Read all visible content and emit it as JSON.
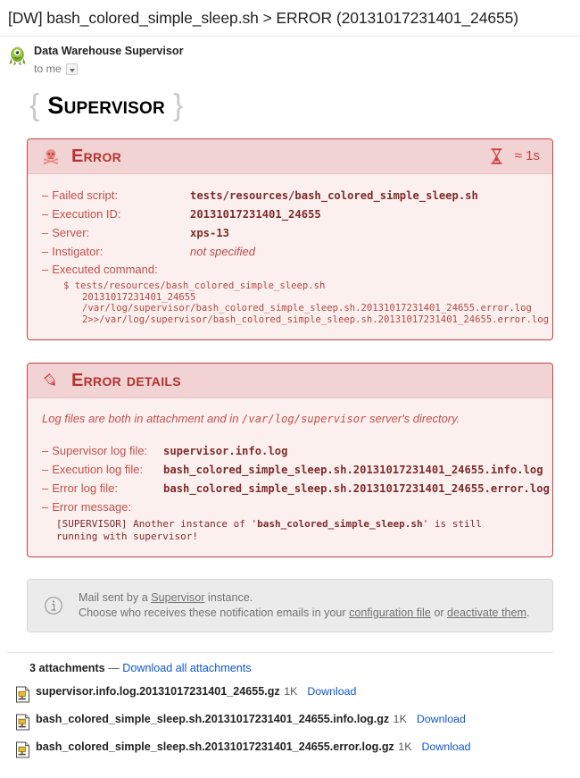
{
  "subject": "[DW] bash_colored_simple_sleep.sh > ERROR (20131017231401_24655)",
  "sender": {
    "name": "Data Warehouse Supervisor",
    "recipient": "to me",
    "avatar_icon": "green-monster-avatar-icon",
    "caret_icon": "chevron-down-icon"
  },
  "wordmark": {
    "left_brace": "{",
    "text": "Supervisor",
    "right_brace": "}"
  },
  "error_panel": {
    "icon": "skull-and-crossbones-icon",
    "title": "Error",
    "duration_icon": "hourglass-icon",
    "duration": "≈ 1s",
    "rows": [
      {
        "key": "Failed script:",
        "value": "tests/resources/bash_colored_simple_sleep.sh",
        "style": "mono"
      },
      {
        "key": "Execution ID:",
        "value": "20131017231401_24655",
        "style": "mono"
      },
      {
        "key": "Server:",
        "value": "xps-13",
        "style": "mono"
      },
      {
        "key": "Instigator:",
        "value": "not specified",
        "style": "plain"
      }
    ],
    "command_label": "Executed command:",
    "command_lines": [
      "$ tests/resources/bash_colored_simple_sleep.sh",
      "20131017231401_24655",
      "/var/log/supervisor/bash_colored_simple_sleep.sh.20131017231401_24655.error.log",
      "2>>/var/log/supervisor/bash_colored_simple_sleep.sh.20131017231401_24655.error.log"
    ]
  },
  "details_panel": {
    "icon": "pen-nib-icon",
    "title": "Error details",
    "note_prefix": "Log files are both in attachment and in ",
    "note_path": "/var/log/supervisor",
    "note_suffix": " server's directory.",
    "rows": [
      {
        "key": "Supervisor log file:",
        "value": "supervisor.info.log"
      },
      {
        "key": "Execution log file:",
        "value": "bash_colored_simple_sleep.sh.20131017231401_24655.info.log"
      },
      {
        "key": "Error log file:",
        "value": "bash_colored_simple_sleep.sh.20131017231401_24655.error.log"
      }
    ],
    "message_label": "Error message:",
    "message_pre": "[SUPERVISOR] Another instance of '",
    "message_bold": "bash_colored_simple_sleep.sh",
    "message_post": "' is still running with supervisor!"
  },
  "info_box": {
    "icon": "info-circle-icon",
    "line1_pre": "Mail sent by a ",
    "line1_link": "Supervisor",
    "line1_post": " instance.",
    "line2_pre": "Choose who receives these notification emails in your ",
    "line2_link1": "configuration file",
    "line2_mid": " or ",
    "line2_link2": "deactivate them",
    "line2_post": "."
  },
  "attachments": {
    "count_label": "3 attachments",
    "separator": "—",
    "download_all": "Download all attachments",
    "items": [
      {
        "icon": "gzip-file-icon",
        "name": "supervisor.info.log.20131017231401_24655.gz",
        "size": "1K",
        "action": "Download"
      },
      {
        "icon": "gzip-file-icon",
        "name": "bash_colored_simple_sleep.sh.20131017231401_24655.info.log.gz",
        "size": "1K",
        "action": "Download"
      },
      {
        "icon": "gzip-file-icon",
        "name": "bash_colored_simple_sleep.sh.20131017231401_24655.error.log.gz",
        "size": "1K",
        "action": "Download"
      }
    ]
  },
  "colors": {
    "error_border": "#c8413f",
    "error_head_bg": "#f2d3d3",
    "error_body_bg": "#fcf0ef",
    "error_title": "#b5322f",
    "link": "#1155cc",
    "info_bg": "#ebebeb"
  }
}
